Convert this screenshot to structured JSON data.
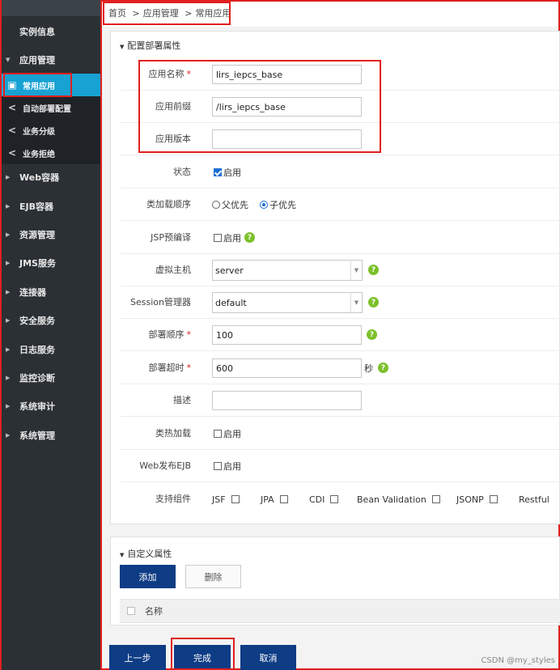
{
  "breadcrumb": {
    "home": "首页",
    "sep1": ">",
    "level1": "应用管理",
    "sep2": ">",
    "level2": "常用应用"
  },
  "sidebar": {
    "top_item": "实例信息",
    "app_mgmt": "应用管理",
    "sub_items": [
      "常用应用",
      "自动部署配置",
      "业务分级",
      "业务拒绝"
    ],
    "groups": [
      "Web容器",
      "EJB容器",
      "资源管理",
      "JMS服务",
      "连接器",
      "安全服务",
      "日志服务",
      "监控诊断",
      "系统审计",
      "系统管理"
    ]
  },
  "deploy": {
    "section_title": "配置部署属性",
    "app_name": {
      "label": "应用名称",
      "req": "*",
      "value": "lirs_iepcs_base"
    },
    "app_prefix": {
      "label": "应用前缀",
      "value": "/lirs_iepcs_base"
    },
    "app_version": {
      "label": "应用版本",
      "value": ""
    },
    "status": {
      "label": "状态",
      "option": "启用"
    },
    "classload": {
      "label": "类加载顺序",
      "opt1": "父优先",
      "opt2": "子优先"
    },
    "jsp_precompile": {
      "label": "JSP预编译",
      "option": "启用"
    },
    "vhost": {
      "label": "虚拟主机",
      "value": "server"
    },
    "session_mgr": {
      "label": "Session管理器",
      "value": "default"
    },
    "deploy_order": {
      "label": "部署顺序",
      "req": "*",
      "value": "100"
    },
    "deploy_timeout": {
      "label": "部署超时",
      "req": "*",
      "value": "600",
      "unit": "秒"
    },
    "description": {
      "label": "描述",
      "value": ""
    },
    "hot_reload": {
      "label": "类热加载",
      "option": "启用"
    },
    "web_ejb": {
      "label": "Web发布EJB",
      "option": "启用"
    },
    "components": {
      "label": "支持组件",
      "items": [
        "JSF",
        "JPA",
        "CDI",
        "Bean Validation",
        "JSONP",
        "Restful"
      ]
    }
  },
  "custom": {
    "section_title": "自定义属性",
    "add_label": "添加",
    "delete_label": "删除",
    "col_name": "名称"
  },
  "footer": {
    "prev_label": "上一步",
    "finish_label": "完成",
    "cancel_label": "取消"
  },
  "watermark": "CSDN @my_styles",
  "icons": {
    "help": "?"
  },
  "colors": {
    "sidebar_bg": "#2b3035",
    "active": "#17a2d3",
    "primary_btn": "#0e3c85",
    "highlight": "#e02020",
    "help": "#7cc12b"
  }
}
